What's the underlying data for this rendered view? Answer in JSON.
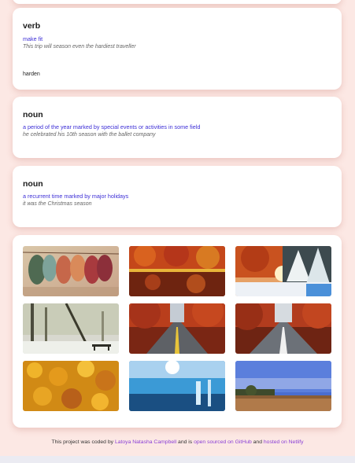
{
  "meanings": [
    {
      "part_of_speech": "verb",
      "definition": "make fit",
      "example": "This trip will season even the hardiest traveller",
      "synonym": "harden"
    },
    {
      "part_of_speech": "noun",
      "definition": "a period of the year marked by special events or activities in some field",
      "example": "he celebrated his 10th season with the ballet company"
    },
    {
      "part_of_speech": "noun",
      "definition": "a recurrent time marked by major holidays",
      "example": "it was the Christmas season"
    }
  ],
  "gallery": {
    "images": [
      "autumn-leaves-photo",
      "autumn-lake-reflection-photo",
      "autumn-winter-trees-photo",
      "foggy-park-bench-photo",
      "autumn-forest-road-photo",
      "autumn-forest-road-wet-photo",
      "yellow-leaves-photo",
      "ice-glacier-photo",
      "autumn-field-sky-photo"
    ]
  },
  "footer": {
    "prefix": "This project was coded by",
    "author": "Latoya Natasha Campbell",
    "middle": "and is",
    "source_link": "open sourced on GitHub",
    "and": "and",
    "host_link": "hosted on Netlify"
  },
  "colors": {
    "background": "#fce8e4",
    "definition": "#3d2fd6",
    "link": "#8a3fd6"
  }
}
